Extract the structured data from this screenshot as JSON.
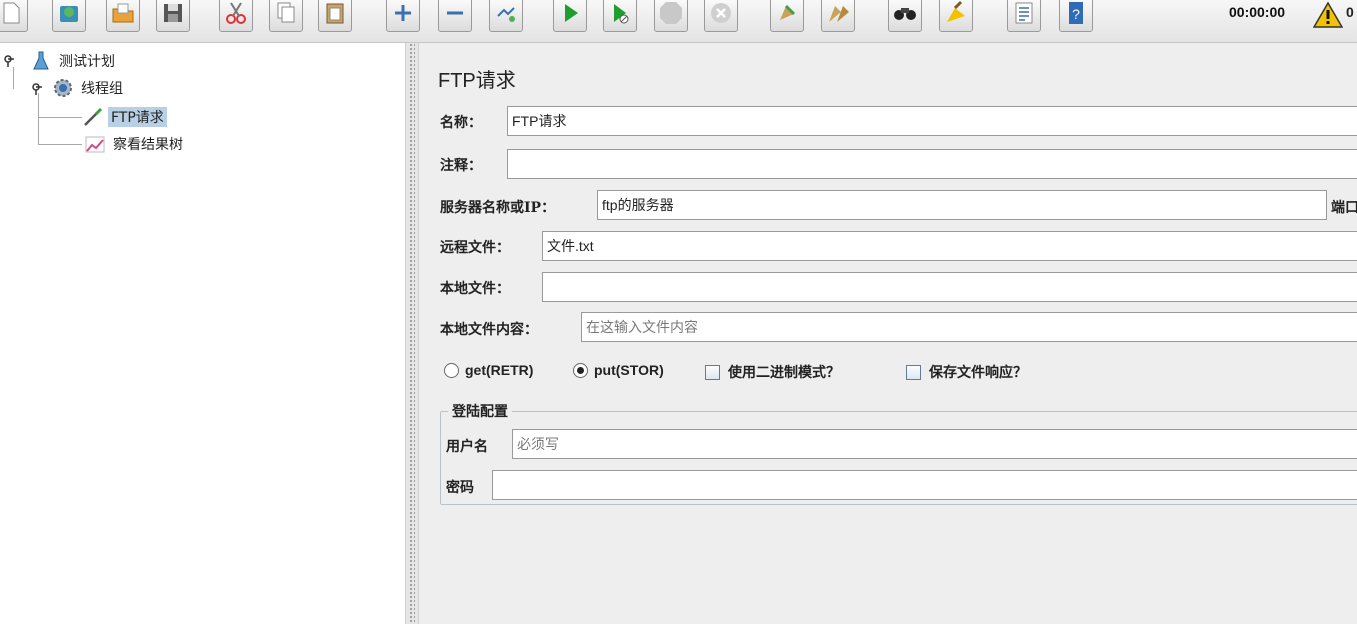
{
  "toolbar": {
    "buttons": [
      {
        "name": "new-icon"
      },
      {
        "name": "templates-icon"
      },
      {
        "name": "open-icon"
      },
      {
        "name": "save-icon"
      },
      {
        "name": "cut-icon"
      },
      {
        "name": "copy-icon"
      },
      {
        "name": "paste-icon"
      },
      {
        "name": "expand-icon"
      },
      {
        "name": "collapse-icon"
      },
      {
        "name": "toggle-icon"
      },
      {
        "name": "start-icon"
      },
      {
        "name": "start-no-pauses-icon"
      },
      {
        "name": "stop-icon"
      },
      {
        "name": "shutdown-icon"
      },
      {
        "name": "clear-icon"
      },
      {
        "name": "clear-all-icon"
      },
      {
        "name": "search-icon"
      },
      {
        "name": "reset-search-icon"
      },
      {
        "name": "function-helper-icon"
      },
      {
        "name": "help-icon"
      }
    ],
    "timer": "00:00:00",
    "warning_count": "0"
  },
  "tree": {
    "items": [
      {
        "label": "测试计划",
        "icon": "test-plan-icon"
      },
      {
        "label": "线程组",
        "icon": "thread-group-icon"
      },
      {
        "label": "FTP请求",
        "icon": "sampler-icon",
        "selected": true
      },
      {
        "label": "察看结果树",
        "icon": "listener-icon"
      }
    ]
  },
  "panel": {
    "title": "FTP请求",
    "name_label": "名称：",
    "name_value": "FTP请求",
    "comment_label": "注释：",
    "comment_value": "",
    "server_label": "服务器名称或IP：",
    "server_value": "ftp的服务器",
    "port_label_cut": "端口",
    "remote_label": "远程文件：",
    "remote_value": "文件.txt",
    "local_label": "本地文件：",
    "local_value": "",
    "local_content_label": "本地文件内容：",
    "local_content_placeholder": "在这输入文件内容",
    "options": {
      "get_label": "get(RETR)",
      "put_label": "put(STOR)",
      "selected": "put",
      "binary_label": "使用二进制模式？",
      "binary_checked": false,
      "save_label": "保存文件响应？",
      "save_checked": false
    },
    "login": {
      "title": "登陆配置",
      "user_label": "用户名",
      "user_placeholder": "必须写",
      "password_label": "密码",
      "password_value": ""
    }
  },
  "colors": {
    "selection": "#b8cfe5",
    "start_green": "#1f9e2f",
    "warning": "#f2c200"
  }
}
